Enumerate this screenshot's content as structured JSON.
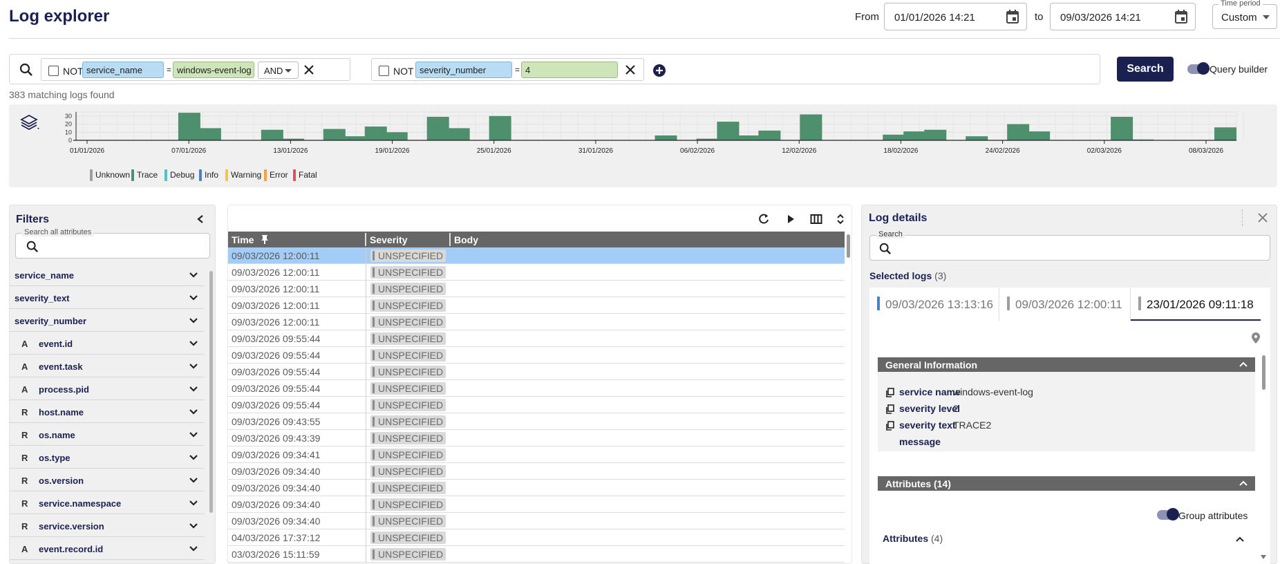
{
  "header": {
    "title": "Log explorer",
    "from_label": "From",
    "from_value": "01/01/2026 14:21",
    "to_label": "to",
    "to_value": "09/03/2026 14:21",
    "time_period_label": "Time period",
    "time_period_value": "Custom"
  },
  "query": {
    "clauses": [
      {
        "not_label": "NOT",
        "key": "service_name",
        "op": "=",
        "value": "windows-event-log",
        "joiner": "AND"
      },
      {
        "not_label": "NOT",
        "key": "severity_number",
        "op": "=",
        "value": "4"
      }
    ],
    "search_label": "Search",
    "query_builder_label": "Query builder",
    "match_count": "383 matching logs found"
  },
  "histogram": {
    "legend": [
      {
        "label": "Unknown",
        "color": "#9e9e9e"
      },
      {
        "label": "Trace",
        "color": "#4e8f6d"
      },
      {
        "label": "Debug",
        "color": "#4ec4c4"
      },
      {
        "label": "Info",
        "color": "#3a86d4"
      },
      {
        "label": "Warning",
        "color": "#f5c542"
      },
      {
        "label": "Error",
        "color": "#f5a142"
      },
      {
        "label": "Fatal",
        "color": "#e84b5a"
      }
    ]
  },
  "chart_data": {
    "type": "bar",
    "series": [
      {
        "name": "Trace",
        "color": "#4e8f6d",
        "values": [
          0,
          0,
          0,
          0,
          34,
          15,
          0,
          0,
          13,
          2,
          0,
          14,
          5,
          17,
          10,
          0,
          29,
          15,
          0,
          30,
          0,
          0,
          0,
          0,
          0,
          0,
          0,
          6,
          0,
          2,
          23,
          6,
          12,
          0,
          32,
          0,
          0,
          0,
          7,
          11,
          13,
          0,
          5,
          0,
          20,
          11,
          0,
          0,
          0,
          29,
          1,
          0,
          0,
          0,
          16
        ]
      }
    ],
    "x_tick_labels": [
      "01/01/2026",
      "07/01/2026",
      "13/01/2026",
      "19/01/2026",
      "25/01/2026",
      "31/01/2026",
      "06/02/2026",
      "12/02/2026",
      "18/02/2026",
      "24/02/2026",
      "02/03/2026",
      "08/03/2026"
    ],
    "y_tick_labels": [
      "30",
      "20",
      "10",
      "0"
    ],
    "ylim": [
      0,
      35
    ]
  },
  "filters": {
    "title": "Filters",
    "search_label": "Search all attributes",
    "items": [
      {
        "prefix": "",
        "name": "service_name"
      },
      {
        "prefix": "",
        "name": "severity_text"
      },
      {
        "prefix": "",
        "name": "severity_number"
      },
      {
        "prefix": "A",
        "name": "event.id"
      },
      {
        "prefix": "A",
        "name": "event.task"
      },
      {
        "prefix": "A",
        "name": "process.pid"
      },
      {
        "prefix": "R",
        "name": "host.name"
      },
      {
        "prefix": "R",
        "name": "os.name"
      },
      {
        "prefix": "R",
        "name": "os.type"
      },
      {
        "prefix": "R",
        "name": "os.version"
      },
      {
        "prefix": "R",
        "name": "service.namespace"
      },
      {
        "prefix": "R",
        "name": "service.version"
      },
      {
        "prefix": "A",
        "name": "event.record.id"
      }
    ]
  },
  "table": {
    "columns": [
      "Time",
      "Severity",
      "Body"
    ],
    "rows": [
      {
        "time": "09/03/2026 12:00:11",
        "severity": "UNSPECIFIED"
      },
      {
        "time": "09/03/2026 12:00:11",
        "severity": "UNSPECIFIED"
      },
      {
        "time": "09/03/2026 12:00:11",
        "severity": "UNSPECIFIED"
      },
      {
        "time": "09/03/2026 12:00:11",
        "severity": "UNSPECIFIED"
      },
      {
        "time": "09/03/2026 12:00:11",
        "severity": "UNSPECIFIED"
      },
      {
        "time": "09/03/2026 09:55:44",
        "severity": "UNSPECIFIED"
      },
      {
        "time": "09/03/2026 09:55:44",
        "severity": "UNSPECIFIED"
      },
      {
        "time": "09/03/2026 09:55:44",
        "severity": "UNSPECIFIED"
      },
      {
        "time": "09/03/2026 09:55:44",
        "severity": "UNSPECIFIED"
      },
      {
        "time": "09/03/2026 09:55:44",
        "severity": "UNSPECIFIED"
      },
      {
        "time": "09/03/2026 09:43:55",
        "severity": "UNSPECIFIED"
      },
      {
        "time": "09/03/2026 09:43:39",
        "severity": "UNSPECIFIED"
      },
      {
        "time": "09/03/2026 09:34:41",
        "severity": "UNSPECIFIED"
      },
      {
        "time": "09/03/2026 09:34:40",
        "severity": "UNSPECIFIED"
      },
      {
        "time": "09/03/2026 09:34:40",
        "severity": "UNSPECIFIED"
      },
      {
        "time": "09/03/2026 09:34:40",
        "severity": "UNSPECIFIED"
      },
      {
        "time": "09/03/2026 09:34:40",
        "severity": "UNSPECIFIED"
      },
      {
        "time": "04/03/2026 17:37:12",
        "severity": "UNSPECIFIED"
      },
      {
        "time": "03/03/2026 15:11:59",
        "severity": "UNSPECIFIED"
      }
    ]
  },
  "details": {
    "title": "Log details",
    "search_label": "Search",
    "selected_label": "Selected logs",
    "selected_count": "(3)",
    "tabs": [
      {
        "label": "09/03/2026 13:13:16",
        "color": "#3a86d4"
      },
      {
        "label": "09/03/2026 12:00:11",
        "color": "#9e9e9e"
      },
      {
        "label": "23/01/2026 09:11:18",
        "color": "#9e9e9e"
      }
    ],
    "general_title": "General Information",
    "general": [
      {
        "key": "service name",
        "value": "windows-event-log"
      },
      {
        "key": "severity level",
        "value": "2"
      },
      {
        "key": "severity text",
        "value": "TRACE2"
      },
      {
        "key": "message",
        "value": ""
      }
    ],
    "attributes_title": "Attributes (14)",
    "group_label": "Group attributes",
    "attributes_sub": "Attributes",
    "attributes_sub_count": "(4)"
  }
}
